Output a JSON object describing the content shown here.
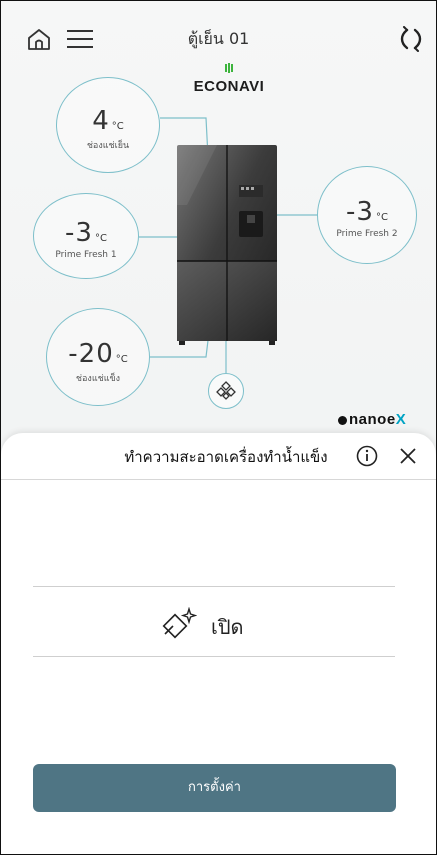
{
  "header": {
    "title": "ตู้เย็น 01",
    "home_icon": "home-icon",
    "menu_icon": "menu-icon",
    "refresh_icon": "refresh-icon"
  },
  "brand": {
    "econavi": "ECONAVI",
    "nanoe_prefix": "nanoe",
    "nanoe_suffix": "X"
  },
  "compartments": [
    {
      "value": "4",
      "unit": "°C",
      "label": "ช่องแช่เย็น"
    },
    {
      "value": "-3",
      "unit": "°C",
      "label": "Prime Fresh 1"
    },
    {
      "value": "-3",
      "unit": "°C",
      "label": "Prime Fresh 2"
    },
    {
      "value": "-20",
      "unit": "°C",
      "label": "ช่องแช่แข็ง"
    }
  ],
  "sheet": {
    "title": "ทำความสะอาดเครื่องทำน้ำแข็ง",
    "mode_label": "เปิด",
    "button_label": "การตั้งค่า"
  },
  "colors": {
    "accent": "#7dbfca",
    "button": "#4f7584",
    "nanoe_x": "#00a3c4"
  }
}
